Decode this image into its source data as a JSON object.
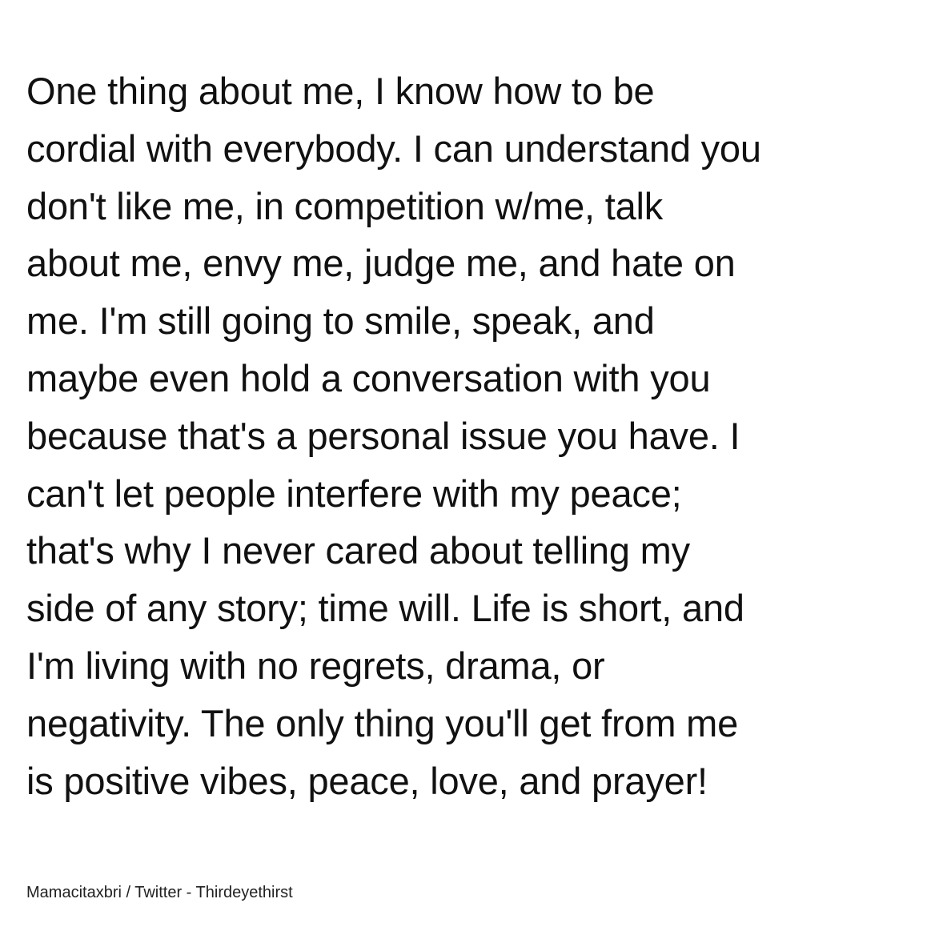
{
  "quote": {
    "lines": [
      "One thing about me, I know how to be",
      "cordial with everybody. I can understand you",
      "don't like me, in competition w/me, talk",
      "about me, envy me, judge me, and hate on",
      "me. I'm still going to smile, speak, and",
      "maybe even hold a conversation with you",
      "because that's a personal issue you have. I",
      "can't let people interfere with my peace;",
      "that's why I never cared about telling my",
      "side of any story; time will. Life is short, and",
      "I'm living with no regrets, drama, or",
      "negativity. The only thing you'll get from me",
      "is positive vibes, peace, love, and prayer!"
    ]
  },
  "attribution": "Mamacitaxbri / Twitter - Thirdeyethirst",
  "colors": {
    "background": "#ffffff",
    "text": "#111111"
  }
}
